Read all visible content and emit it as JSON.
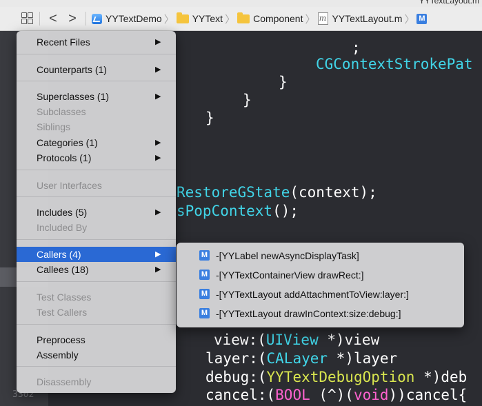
{
  "window": {
    "title_fragment": "YYTextLayout.m"
  },
  "pathbar": {
    "back_glyph": "<",
    "forward_glyph": ">",
    "crumbs": [
      {
        "label": "YYTextDemo",
        "icon": "project-icon"
      },
      {
        "label": "YYText",
        "icon": "folder-icon"
      },
      {
        "label": "Component",
        "icon": "folder-icon"
      },
      {
        "label": "YYTextLayout.m",
        "icon": "m-file-icon"
      },
      {
        "label": "M",
        "icon": "method-icon"
      }
    ]
  },
  "menu": {
    "items": [
      {
        "label": "Recent Files",
        "submenu": true,
        "enabled": true
      },
      {
        "label": "Counterparts (1)",
        "submenu": true,
        "enabled": true
      },
      {
        "label": "Superclasses (1)",
        "submenu": true,
        "enabled": true
      },
      {
        "label": "Subclasses",
        "submenu": false,
        "enabled": false
      },
      {
        "label": "Siblings",
        "submenu": false,
        "enabled": false
      },
      {
        "label": "Categories (1)",
        "submenu": true,
        "enabled": true
      },
      {
        "label": "Protocols (1)",
        "submenu": true,
        "enabled": true
      },
      {
        "label": "User Interfaces",
        "submenu": false,
        "enabled": false
      },
      {
        "label": "Includes (5)",
        "submenu": true,
        "enabled": true
      },
      {
        "label": "Included By",
        "submenu": false,
        "enabled": false
      },
      {
        "label": "Callers (4)",
        "submenu": true,
        "enabled": true,
        "selected": true
      },
      {
        "label": "Callees (18)",
        "submenu": true,
        "enabled": true
      },
      {
        "label": "Test Classes",
        "submenu": false,
        "enabled": false
      },
      {
        "label": "Test Callers",
        "submenu": false,
        "enabled": false
      },
      {
        "label": "Preprocess",
        "submenu": false,
        "enabled": true
      },
      {
        "label": "Assembly",
        "submenu": false,
        "enabled": true
      },
      {
        "label": "Disassembly",
        "submenu": false,
        "enabled": false
      }
    ],
    "arrow_glyph": "▶"
  },
  "callers_submenu": {
    "icon_letter": "M",
    "items": [
      "-[YYLabel newAsyncDisplayTask]",
      "-[YYTextContainerView drawRect:]",
      "-[YYTextLayout addAttachmentToView:layer:]",
      "-[YYTextLayout drawInContext:size:debug:]"
    ]
  },
  "code": {
    "semicolon": ";",
    "stroke_call": "CGContextStrokePat",
    "brace": "}",
    "restore_fn": "RestoreGState",
    "restore_args": "(context);",
    "pop_fn": "sPopContext",
    "pop_args": "();",
    "line_view": {
      "a": "view:(",
      "type": "UIView",
      "b": " *)view"
    },
    "line_layer": {
      "a": "layer:(",
      "type": "CALayer",
      "b": " *)layer"
    },
    "line_debug": {
      "a": "debug:(",
      "type": "YYTextDebugOption",
      "b": " *)deb"
    },
    "line_cancel": {
      "a": "cancel:(",
      "type": "BOOL",
      "b": " (^)(",
      "kw": "void",
      "c": "))cancel{"
    },
    "gutter_number": "3302"
  },
  "colors": {
    "editor_bg": "#2b2c31",
    "cyan": "#41d5e8",
    "pink": "#fd62cf",
    "yellow": "#d9e64f",
    "selection": "#2a69d4"
  }
}
